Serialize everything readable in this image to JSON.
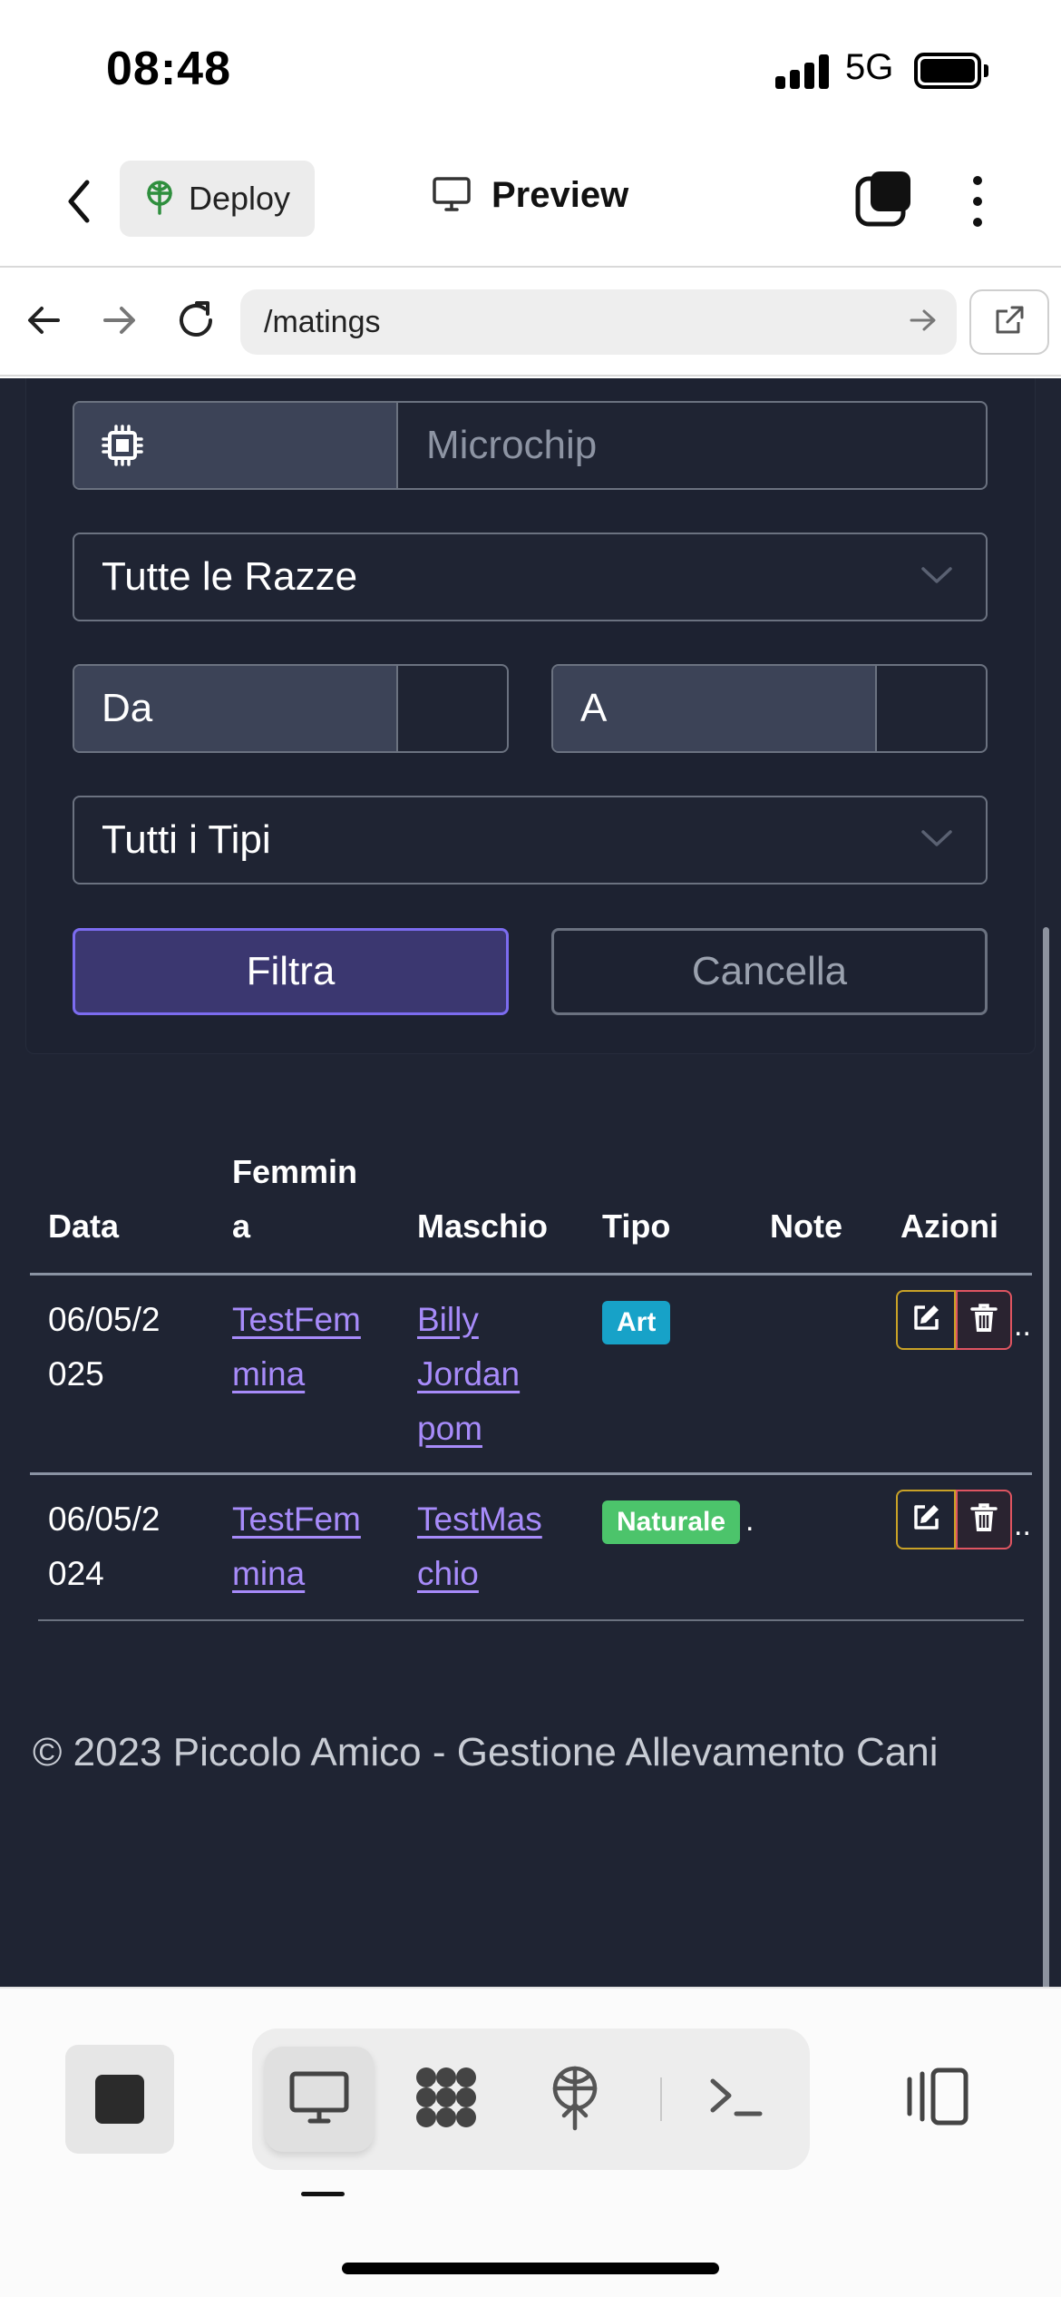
{
  "status": {
    "time": "08:48",
    "network": "5G",
    "signal_bars": 4,
    "battery_level": 1.0
  },
  "header": {
    "deploy_label": "Deploy",
    "title": "Preview"
  },
  "browser": {
    "url": "/matings"
  },
  "filters": {
    "microchip_placeholder": "Microchip",
    "breed_select": "Tutte le Razze",
    "date_from_placeholder": "Da",
    "date_to_placeholder": "A",
    "type_select": "Tutti i Tipi",
    "filter_button": "Filtra",
    "cancel_button": "Cancella"
  },
  "table": {
    "columns": [
      "Data",
      "Femmina",
      "Maschio",
      "Tipo",
      "Note",
      "Azioni"
    ],
    "column_display": {
      "femmina_line1": "Femmin",
      "femmina_line2": "a"
    },
    "rows": [
      {
        "date_l1": "06/05/2",
        "date_l2": "025",
        "female_l1": "TestFem",
        "female_l2": "mina",
        "male_l1": "Billy",
        "male_l2": "Jordan",
        "male_l3": "pom",
        "type": "Art",
        "type_color": "#17a2c8",
        "overflow": "."
      },
      {
        "date_l1": "06/05/2",
        "date_l2": "024",
        "female_l1": "TestFem",
        "female_l2": "mina",
        "male_l1": "TestMas",
        "male_l2": "chio",
        "type": "Naturale",
        "type_color": "#4cc46b",
        "note_overflow": ".",
        "overflow": "."
      }
    ]
  },
  "footer": {
    "text": "© 2023 Piccolo Amico - Gestione Allevamento Cani"
  },
  "colors": {
    "page_bg": "#1f2433",
    "accent": "#7c6cf0",
    "link": "#a78bfa",
    "edit": "#c9a227",
    "delete": "#e05561"
  },
  "toolbar": {
    "items": [
      "stop-icon",
      "desktop-icon",
      "apps-icon",
      "deploy-icon",
      "terminal-icon",
      "split-view-icon"
    ]
  }
}
